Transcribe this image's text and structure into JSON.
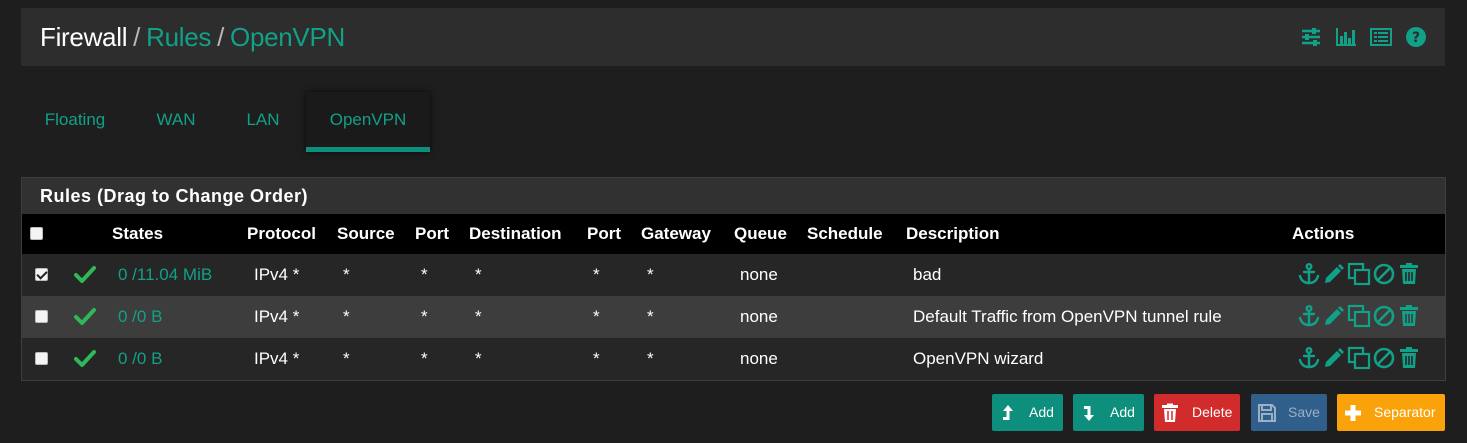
{
  "breadcrumb": {
    "root": "Firewall",
    "separator": "/",
    "level2": "Rules",
    "level3": "OpenVPN"
  },
  "header_icons": [
    "sliders-icon",
    "bar-chart-icon",
    "list-icon",
    "help-icon"
  ],
  "tabs": [
    {
      "label": "Floating",
      "active": false
    },
    {
      "label": "WAN",
      "active": false
    },
    {
      "label": "LAN",
      "active": false
    },
    {
      "label": "OpenVPN",
      "active": true
    }
  ],
  "panel": {
    "title": "Rules (Drag to Change Order)"
  },
  "columns": {
    "states": "States",
    "protocol": "Protocol",
    "source": "Source",
    "port1": "Port",
    "destination": "Destination",
    "port2": "Port",
    "gateway": "Gateway",
    "queue": "Queue",
    "schedule": "Schedule",
    "description": "Description",
    "actions": "Actions"
  },
  "rows": [
    {
      "checked": true,
      "states": "0 /11.04 MiB",
      "protocol": "IPv4 *",
      "source": "*",
      "port1": "*",
      "destination": "*",
      "port2": "*",
      "gateway": "*",
      "queue": "none",
      "schedule": "",
      "description": "bad"
    },
    {
      "checked": false,
      "states": "0 /0 B",
      "protocol": "IPv4 *",
      "source": "*",
      "port1": "*",
      "destination": "*",
      "port2": "*",
      "gateway": "*",
      "queue": "none",
      "schedule": "",
      "description": "Default Traffic from OpenVPN tunnel rule"
    },
    {
      "checked": false,
      "states": "0 /0 B",
      "protocol": "IPv4 *",
      "source": "*",
      "port1": "*",
      "destination": "*",
      "port2": "*",
      "gateway": "*",
      "queue": "none",
      "schedule": "",
      "description": "OpenVPN wizard"
    }
  ],
  "row_action_icons": [
    "anchor-icon",
    "pencil-icon",
    "copy-icon",
    "disable-icon",
    "trash-icon"
  ],
  "buttons": {
    "add_top": "Add",
    "add_bottom": "Add",
    "delete": "Delete",
    "save": "Save",
    "separator": "Separator"
  },
  "colors": {
    "accent": "#11a088",
    "success": "#2eb857",
    "danger": "#d22b2b",
    "warning": "#f9a20a",
    "save": "#2f5f8a"
  }
}
